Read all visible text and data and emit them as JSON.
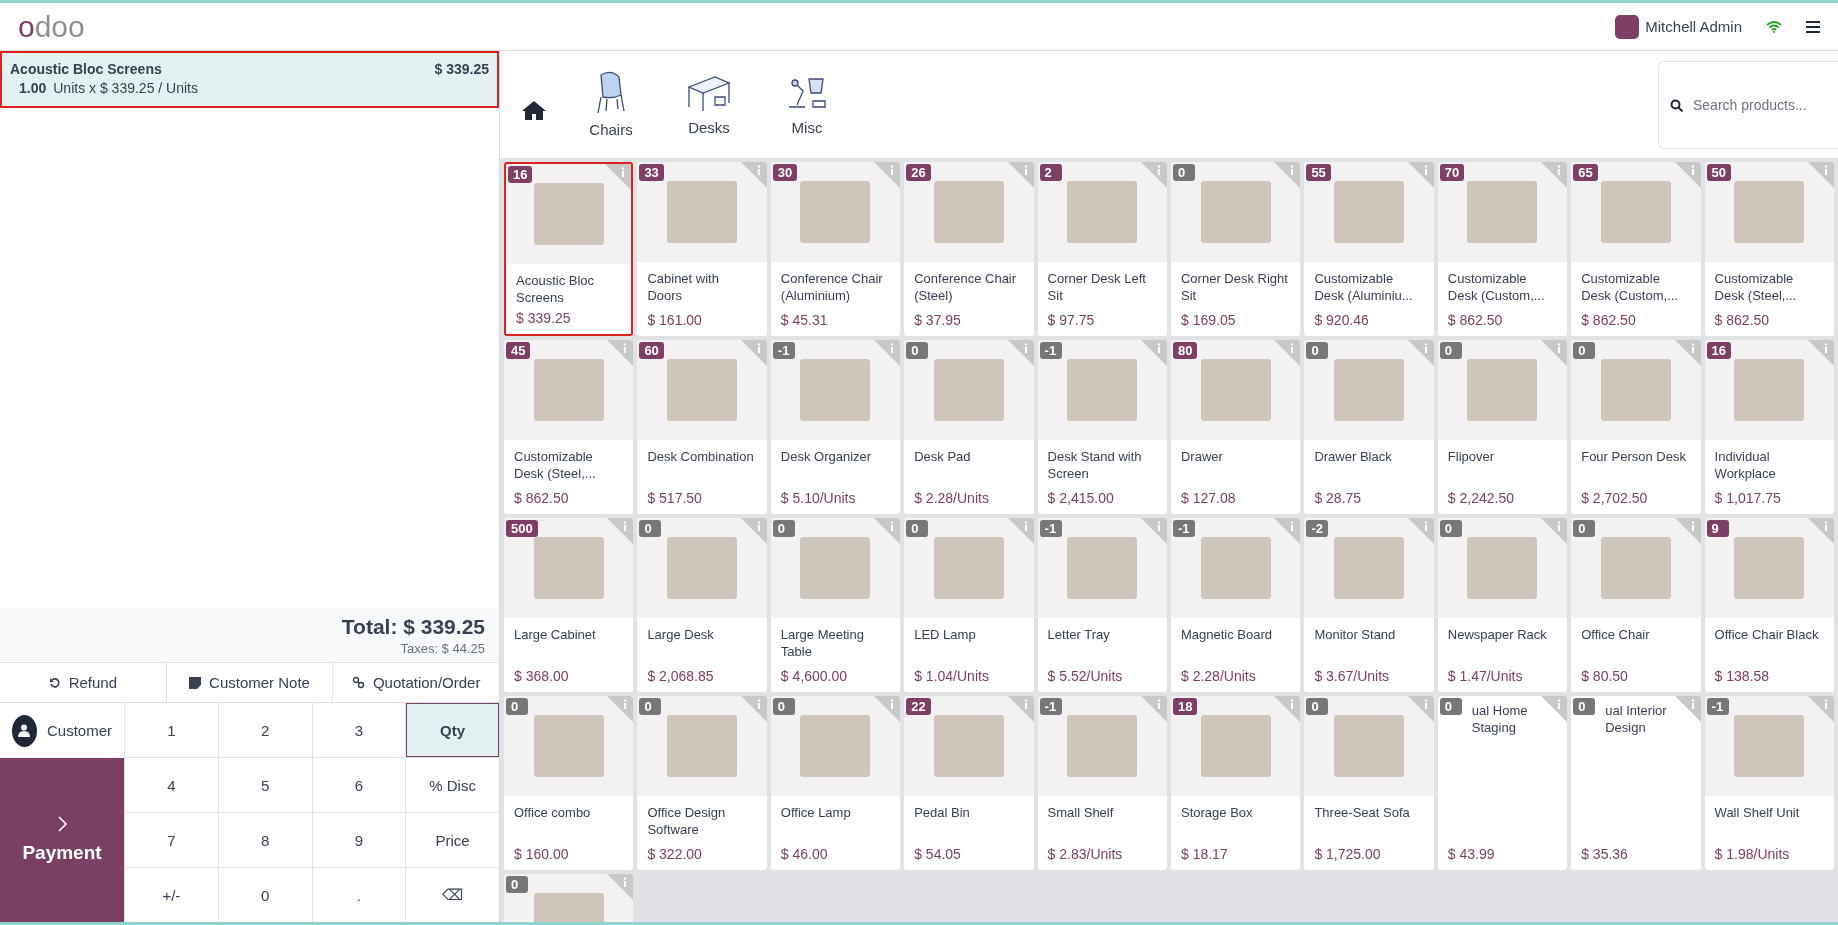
{
  "header": {
    "logo": "odoo",
    "user": "Mitchell Admin"
  },
  "order": {
    "lines": [
      {
        "name": "Acoustic Bloc Screens",
        "price": "$ 339.25",
        "qty": "1.00",
        "detail": "Units x $ 339.25 / Units",
        "highlighted": true
      }
    ],
    "total": "Total: $ 339.25",
    "taxes": "Taxes: $ 44.25"
  },
  "actions": [
    {
      "label": "Refund",
      "kind": "refund"
    },
    {
      "label": "Customer Note",
      "kind": "note"
    },
    {
      "label": "Quotation/Order",
      "kind": "link"
    }
  ],
  "customer": "Customer",
  "payment": "Payment",
  "keys": [
    {
      "label": "1",
      "selected": false
    },
    {
      "label": "2",
      "selected": false
    },
    {
      "label": "3",
      "selected": false
    },
    {
      "label": "Qty",
      "selected": true
    },
    {
      "label": "4",
      "selected": false
    },
    {
      "label": "5",
      "selected": false
    },
    {
      "label": "6",
      "selected": false
    },
    {
      "label": "% Disc",
      "selected": false
    },
    {
      "label": "7",
      "selected": false
    },
    {
      "label": "8",
      "selected": false
    },
    {
      "label": "9",
      "selected": false
    },
    {
      "label": "Price",
      "selected": false
    },
    {
      "label": "+/-",
      "selected": false
    },
    {
      "label": "0",
      "selected": false
    },
    {
      "label": ".",
      "selected": false
    },
    {
      "label": "⌫",
      "selected": false
    }
  ],
  "categories": [
    {
      "label": "Chairs",
      "kind": "chair"
    },
    {
      "label": "Desks",
      "kind": "desk"
    },
    {
      "label": "Misc",
      "kind": "lamp"
    }
  ],
  "search": {
    "placeholder": "Search products..."
  },
  "products": [
    {
      "stock": "16",
      "color": "#7e3f66",
      "name": "Acoustic Bloc Screens",
      "price": "$ 339.25",
      "kind": "image",
      "highlighted": true
    },
    {
      "stock": "33",
      "color": "#7e3f66",
      "name": "Cabinet with Doors",
      "price": "$ 161.00",
      "kind": "image",
      "highlighted": false
    },
    {
      "stock": "30",
      "color": "#7e3f66",
      "name": "Conference Chair (Aluminium)",
      "price": "$ 45.31",
      "kind": "image",
      "highlighted": false
    },
    {
      "stock": "26",
      "color": "#7e3f66",
      "name": "Conference Chair (Steel)",
      "price": "$ 37.95",
      "kind": "image",
      "highlighted": false
    },
    {
      "stock": "2",
      "color": "#7e3f66",
      "name": "Corner Desk Left Sit",
      "price": "$ 97.75",
      "kind": "image",
      "highlighted": false
    },
    {
      "stock": "0",
      "color": "#777777",
      "name": "Corner Desk Right Sit",
      "price": "$ 169.05",
      "kind": "image",
      "highlighted": false
    },
    {
      "stock": "55",
      "color": "#7e3f66",
      "name": "Customizable Desk (Aluminiu...",
      "price": "$ 920.46",
      "kind": "image",
      "highlighted": false
    },
    {
      "stock": "70",
      "color": "#7e3f66",
      "name": "Customizable Desk (Custom,...",
      "price": "$ 862.50",
      "kind": "image",
      "highlighted": false
    },
    {
      "stock": "65",
      "color": "#7e3f66",
      "name": "Customizable Desk (Custom,...",
      "price": "$ 862.50",
      "kind": "image",
      "highlighted": false
    },
    {
      "stock": "50",
      "color": "#7e3f66",
      "name": "Customizable Desk (Steel,...",
      "price": "$ 862.50",
      "kind": "image",
      "highlighted": false
    },
    {
      "stock": "45",
      "color": "#7e3f66",
      "name": "Customizable Desk (Steel,...",
      "price": "$ 862.50",
      "kind": "image",
      "highlighted": false
    },
    {
      "stock": "60",
      "color": "#7e3f66",
      "name": "Desk Combination",
      "price": "$ 517.50",
      "kind": "image",
      "highlighted": false
    },
    {
      "stock": "-1",
      "color": "#777777",
      "name": "Desk Organizer",
      "price": "$ 5.10/Units",
      "kind": "image",
      "highlighted": false
    },
    {
      "stock": "0",
      "color": "#777777",
      "name": "Desk Pad",
      "price": "$ 2.28/Units",
      "kind": "image",
      "highlighted": false
    },
    {
      "stock": "-1",
      "color": "#777777",
      "name": "Desk Stand with Screen",
      "price": "$ 2,415.00",
      "kind": "image",
      "highlighted": false
    },
    {
      "stock": "80",
      "color": "#7e3f66",
      "name": "Drawer",
      "price": "$ 127.08",
      "kind": "image",
      "highlighted": false
    },
    {
      "stock": "0",
      "color": "#777777",
      "name": "Drawer Black",
      "price": "$ 28.75",
      "kind": "image",
      "highlighted": false
    },
    {
      "stock": "0",
      "color": "#777777",
      "name": "Flipover",
      "price": "$ 2,242.50",
      "kind": "image",
      "highlighted": false
    },
    {
      "stock": "0",
      "color": "#777777",
      "name": "Four Person Desk",
      "price": "$ 2,702.50",
      "kind": "image",
      "highlighted": false
    },
    {
      "stock": "16",
      "color": "#7e3f66",
      "name": "Individual Workplace",
      "price": "$ 1,017.75",
      "kind": "image",
      "highlighted": false
    },
    {
      "stock": "500",
      "color": "#7e3f66",
      "name": "Large Cabinet",
      "price": "$ 368.00",
      "kind": "image",
      "highlighted": false
    },
    {
      "stock": "0",
      "color": "#777777",
      "name": "Large Desk",
      "price": "$ 2,068.85",
      "kind": "image",
      "highlighted": false
    },
    {
      "stock": "0",
      "color": "#777777",
      "name": "Large Meeting Table",
      "price": "$ 4,600.00",
      "kind": "image",
      "highlighted": false
    },
    {
      "stock": "0",
      "color": "#777777",
      "name": "LED Lamp",
      "price": "$ 1.04/Units",
      "kind": "image",
      "highlighted": false
    },
    {
      "stock": "-1",
      "color": "#777777",
      "name": "Letter Tray",
      "price": "$ 5.52/Units",
      "kind": "image",
      "highlighted": false
    },
    {
      "stock": "-1",
      "color": "#777777",
      "name": "Magnetic Board",
      "price": "$ 2.28/Units",
      "kind": "image",
      "highlighted": false
    },
    {
      "stock": "-2",
      "color": "#777777",
      "name": "Monitor Stand",
      "price": "$ 3.67/Units",
      "kind": "image",
      "highlighted": false
    },
    {
      "stock": "0",
      "color": "#777777",
      "name": "Newspaper Rack",
      "price": "$ 1.47/Units",
      "kind": "image",
      "highlighted": false
    },
    {
      "stock": "0",
      "color": "#777777",
      "name": "Office Chair",
      "price": "$ 80.50",
      "kind": "image",
      "highlighted": false
    },
    {
      "stock": "9",
      "color": "#7e3f66",
      "name": "Office Chair Black",
      "price": "$ 138.58",
      "kind": "image",
      "highlighted": false
    },
    {
      "stock": "0",
      "color": "#777777",
      "name": "Office combo",
      "price": "$ 160.00",
      "kind": "image",
      "highlighted": false
    },
    {
      "stock": "0",
      "color": "#777777",
      "name": "Office Design Software",
      "price": "$ 322.00",
      "kind": "image",
      "highlighted": false
    },
    {
      "stock": "0",
      "color": "#777777",
      "name": "Office Lamp",
      "price": "$ 46.00",
      "kind": "image",
      "highlighted": false
    },
    {
      "stock": "22",
      "color": "#7e3f66",
      "name": "Pedal Bin",
      "price": "$ 54.05",
      "kind": "image",
      "highlighted": false
    },
    {
      "stock": "-1",
      "color": "#777777",
      "name": "Small Shelf",
      "price": "$ 2.83/Units",
      "kind": "image",
      "highlighted": false
    },
    {
      "stock": "18",
      "color": "#7e3f66",
      "name": "Storage Box",
      "price": "$ 18.17",
      "kind": "image",
      "highlighted": false
    },
    {
      "stock": "0",
      "color": "#777777",
      "name": "Three-Seat Sofa",
      "price": "$ 1,725.00",
      "kind": "image",
      "highlighted": false
    },
    {
      "stock": "0",
      "color": "#777777",
      "name": "ual Home Staging",
      "price": "$ 43.99",
      "kind": "text",
      "highlighted": false
    },
    {
      "stock": "0",
      "color": "#777777",
      "name": "ual Interior Design",
      "price": "$ 35.36",
      "kind": "text",
      "highlighted": false
    },
    {
      "stock": "-1",
      "color": "#777777",
      "name": "Wall Shelf Unit",
      "price": "$ 1.98/Units",
      "kind": "image",
      "highlighted": false
    },
    {
      "stock": "0",
      "color": "#777777",
      "kind": "cut",
      "highlighted": false
    }
  ]
}
